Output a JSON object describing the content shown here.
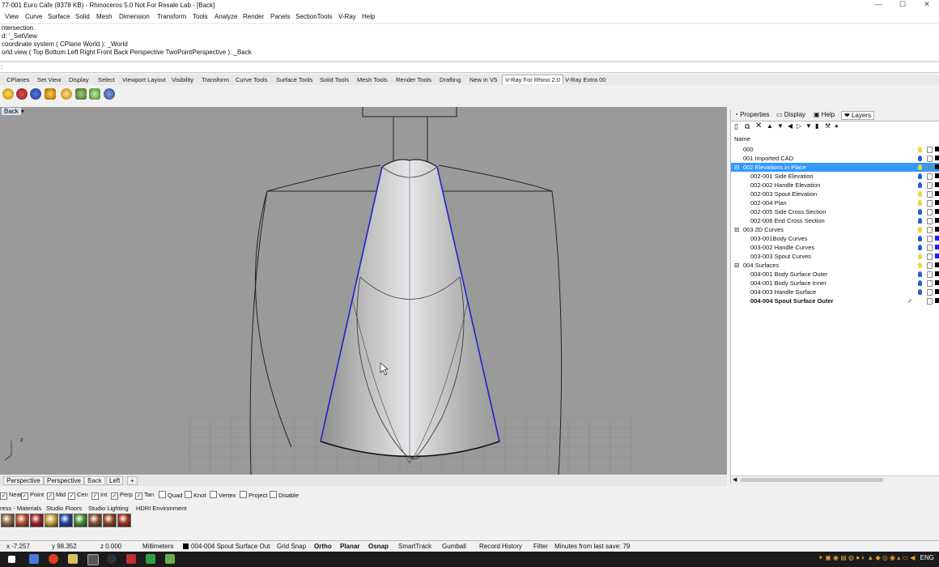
{
  "window": {
    "title": "77-001 Euro Cafe (8378 KB) - Rhinoceros 5.0 Not For Resale Lab - [Back]"
  },
  "menu": [
    "View",
    "Curve",
    "Surface",
    "Solid",
    "Mesh",
    "Dimension",
    "Transform",
    "Tools",
    "Analyze",
    "Render",
    "Panels",
    "SectionTools",
    "V-Ray",
    "Help"
  ],
  "command_history": [
    "ntersection.",
    "d: '_SetView",
    "coordinate system ( CPlane  World ): _World",
    "orld view ( Top  Bottom  Left  Right  Front  Back  Perspective  TwoPointPerspective ): _Back"
  ],
  "command_prompt": ":",
  "toolbar_tabs": [
    "CPlanes",
    "Set View",
    "Display",
    "Select",
    "Viewport Layout",
    "Visibility",
    "Transform",
    "Curve Tools",
    "Surface Tools",
    "Solid Tools",
    "Mesh Tools",
    "Render Tools",
    "Drafting",
    "New in V5",
    "V-Ray For Rhino 2.0",
    "V-Ray Extra 00"
  ],
  "toolbar_active_tab": "V-Ray For Rhino 2.0",
  "viewport": {
    "label": "Back"
  },
  "panel": {
    "tabs": [
      "Properties",
      "Display",
      "Help",
      "Layers"
    ],
    "column_header": "Name",
    "layers": [
      {
        "name": "000",
        "indent": 0,
        "bulb": "yellow",
        "color": "#000000"
      },
      {
        "name": "001 Imported CAD",
        "indent": 0,
        "bulb": "blue",
        "color": "#000000"
      },
      {
        "name": "002 Elevations in Place",
        "indent": 0,
        "bulb": "yellow",
        "color": "#000000",
        "selected": true,
        "expander": "⊟"
      },
      {
        "name": "002-001 Side Elevation",
        "indent": 1,
        "bulb": "blue",
        "color": "#000000"
      },
      {
        "name": "002-002 Handle Elevation",
        "indent": 1,
        "bulb": "blue",
        "color": "#000000"
      },
      {
        "name": "002-003 Spout Elevation",
        "indent": 1,
        "bulb": "yellow",
        "color": "#000000"
      },
      {
        "name": "002-004 Plan",
        "indent": 1,
        "bulb": "yellow",
        "color": "#000000"
      },
      {
        "name": "002-005 Side Cross Section",
        "indent": 1,
        "bulb": "blue",
        "color": "#000000"
      },
      {
        "name": "002-006  End Cross Section",
        "indent": 1,
        "bulb": "blue",
        "color": "#000000"
      },
      {
        "name": "003 2D Curves",
        "indent": 0,
        "bulb": "yellow",
        "color": "#000000",
        "expander": "⊟"
      },
      {
        "name": "003-001Body Curves",
        "indent": 1,
        "bulb": "blue",
        "color": "#1a1aff"
      },
      {
        "name": "003-002 Handle Curves",
        "indent": 1,
        "bulb": "blue",
        "color": "#1a1aff"
      },
      {
        "name": "003-003 Spout Curves",
        "indent": 1,
        "bulb": "yellow",
        "color": "#1a1aff"
      },
      {
        "name": "004 Surfaces",
        "indent": 0,
        "bulb": "yellow",
        "color": "#000000",
        "expander": "⊟"
      },
      {
        "name": "004-001 Body Surface Outer",
        "indent": 1,
        "bulb": "blue",
        "color": "#000000"
      },
      {
        "name": "004-001 Body Surface Inner",
        "indent": 1,
        "bulb": "blue",
        "color": "#000000"
      },
      {
        "name": "004-003 Handle Surface",
        "indent": 1,
        "bulb": "blue",
        "color": "#000000"
      },
      {
        "name": "004-004  Spout Surface Outer",
        "indent": 1,
        "bulb": "",
        "color": "#000000",
        "current": true
      }
    ],
    "current_mark": "✓"
  },
  "viewport_tabs": [
    "Perspective",
    "Perspective",
    "Back",
    "Left",
    "+"
  ],
  "viewport_active": "Back",
  "osnap": [
    {
      "label": "Near",
      "checked": true
    },
    {
      "label": "Point",
      "checked": true
    },
    {
      "label": "Mid",
      "checked": true
    },
    {
      "label": "Cen",
      "checked": true
    },
    {
      "label": "Int",
      "checked": true
    },
    {
      "label": "Perp",
      "checked": true
    },
    {
      "label": "Tan",
      "checked": true
    },
    {
      "label": "Quad",
      "checked": false
    },
    {
      "label": "Knot",
      "checked": false
    },
    {
      "label": "Vertex",
      "checked": false
    },
    {
      "label": "Project",
      "checked": false
    },
    {
      "label": "Disable",
      "checked": false
    }
  ],
  "material_tabs": [
    "ress - Materials",
    "Studio Floors",
    "Studio Lighting",
    "HDRI Environment"
  ],
  "material_colors": [
    "#8a6a3a",
    "#b84a2a",
    "#a02020",
    "#c8a030",
    "#2040a0",
    "#409030",
    "#8a4a30",
    "#904020",
    "#a03020"
  ],
  "status": {
    "x": "x -7.257",
    "y": "y 98.352",
    "z": "z 0.000",
    "units": "Millimeters",
    "layer": "004-004 Spout Surface Outer",
    "toggles": [
      "Grid Snap",
      "Ortho",
      "Planar",
      "Osnap",
      "SmartTrack",
      "Gumball",
      "Record History",
      "Filter"
    ],
    "bold_toggles": [
      "Ortho",
      "Planar",
      "Osnap"
    ],
    "save_info": "Minutes from last save: 79"
  },
  "taskbar": {
    "lang": "ENG"
  },
  "colors": {
    "selection": "#3399ff",
    "viewport_bg": "#9a9a9a",
    "curve_blue": "#2222cc"
  }
}
